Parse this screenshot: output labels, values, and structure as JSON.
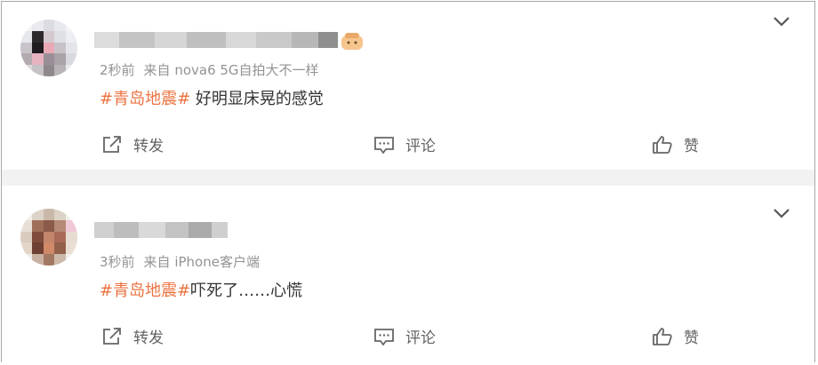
{
  "posts": [
    {
      "username": "",
      "time": "2秒前",
      "source": "来自 nova6 5G自拍大不一样",
      "hashtag": "#青岛地震#",
      "text": " 好明显床晃的感觉",
      "actions": {
        "forward": "转发",
        "comment": "评论",
        "like": "赞"
      }
    },
    {
      "username": "",
      "time": "3秒前",
      "source": "来自 iPhone客户端",
      "hashtag": "#青岛地震#",
      "text": "吓死了……心慌",
      "actions": {
        "forward": "转发",
        "comment": "评论",
        "like": "赞"
      }
    }
  ],
  "colors": {
    "hashtag": "#eb7340",
    "meta": "#939393",
    "separator": "#f2f2f2"
  },
  "icons": [
    "avatar",
    "emoji-icon",
    "chevron-down-icon",
    "forward-icon",
    "comment-icon",
    "like-icon"
  ]
}
